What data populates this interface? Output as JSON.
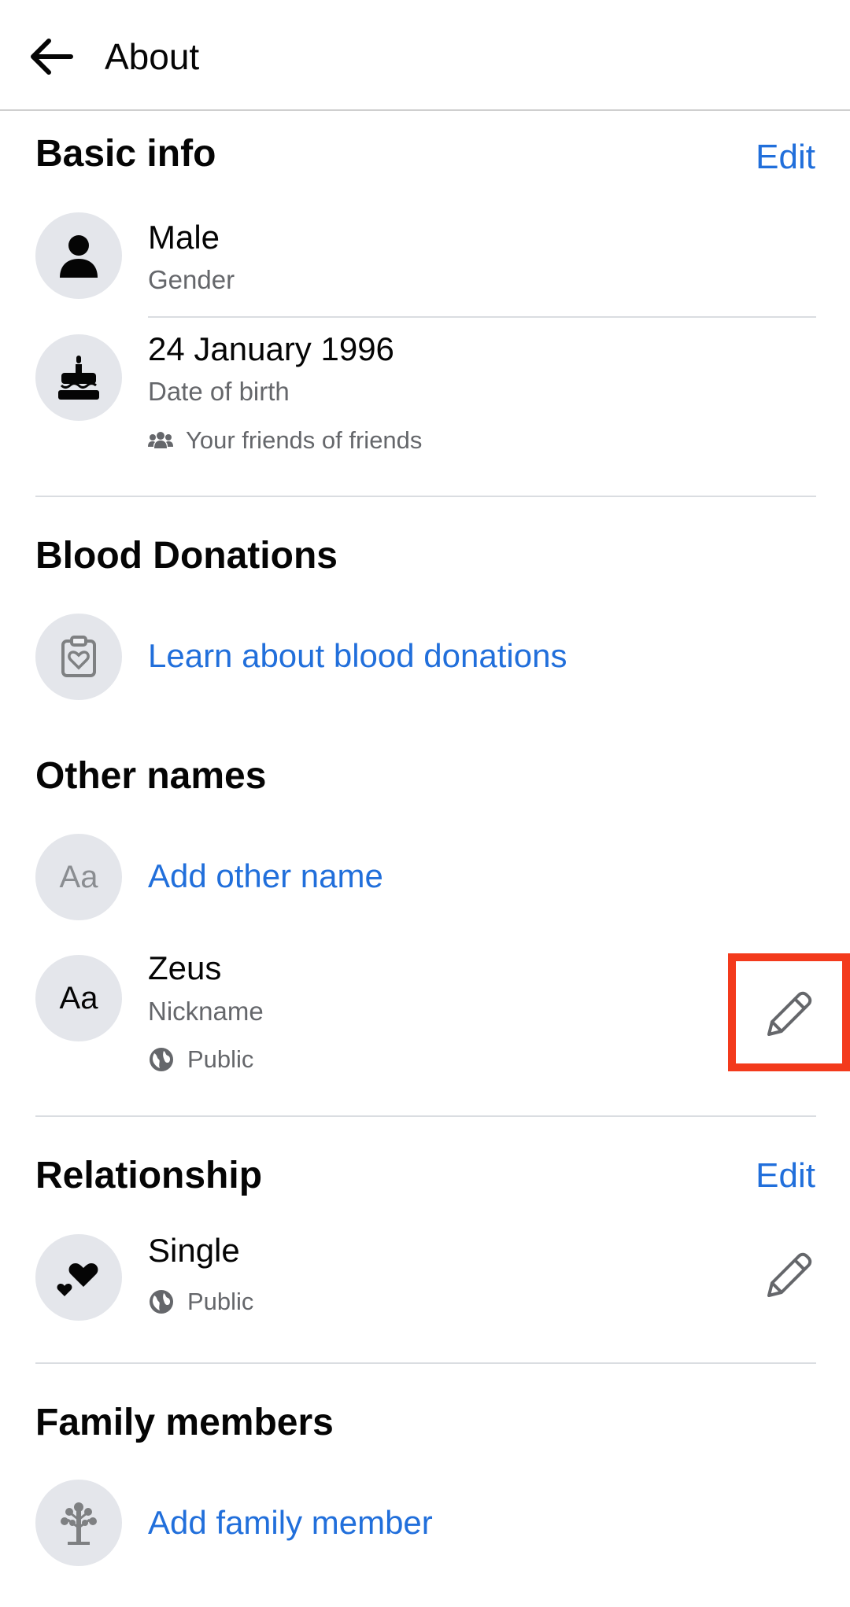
{
  "header": {
    "title": "About",
    "back_icon": "arrow-left-icon"
  },
  "basic_info": {
    "title": "Basic info",
    "edit_label": "Edit",
    "gender": {
      "value": "Male",
      "label": "Gender",
      "icon": "person-icon"
    },
    "birth": {
      "value": "24 January 1996",
      "label": "Date of birth",
      "audience": "Your friends of friends",
      "icon": "cake-icon"
    }
  },
  "blood_donations": {
    "title": "Blood Donations",
    "link": "Learn about blood donations",
    "icon": "clipboard-heart-icon"
  },
  "other_names": {
    "title": "Other names",
    "add_label": "Add other name",
    "add_icon_text": "Aa",
    "nickname": {
      "value": "Zeus",
      "label": "Nickname",
      "audience": "Public",
      "icon_text": "Aa"
    }
  },
  "relationship": {
    "title": "Relationship",
    "edit_label": "Edit",
    "status": {
      "value": "Single",
      "audience": "Public",
      "icon": "hearts-icon"
    }
  },
  "family_members": {
    "title": "Family members",
    "add_label": "Add family member",
    "icon": "family-tree-icon"
  },
  "colors": {
    "link": "#216fdb",
    "highlight": "#f33a1c",
    "circle_bg": "#e4e6eb"
  }
}
